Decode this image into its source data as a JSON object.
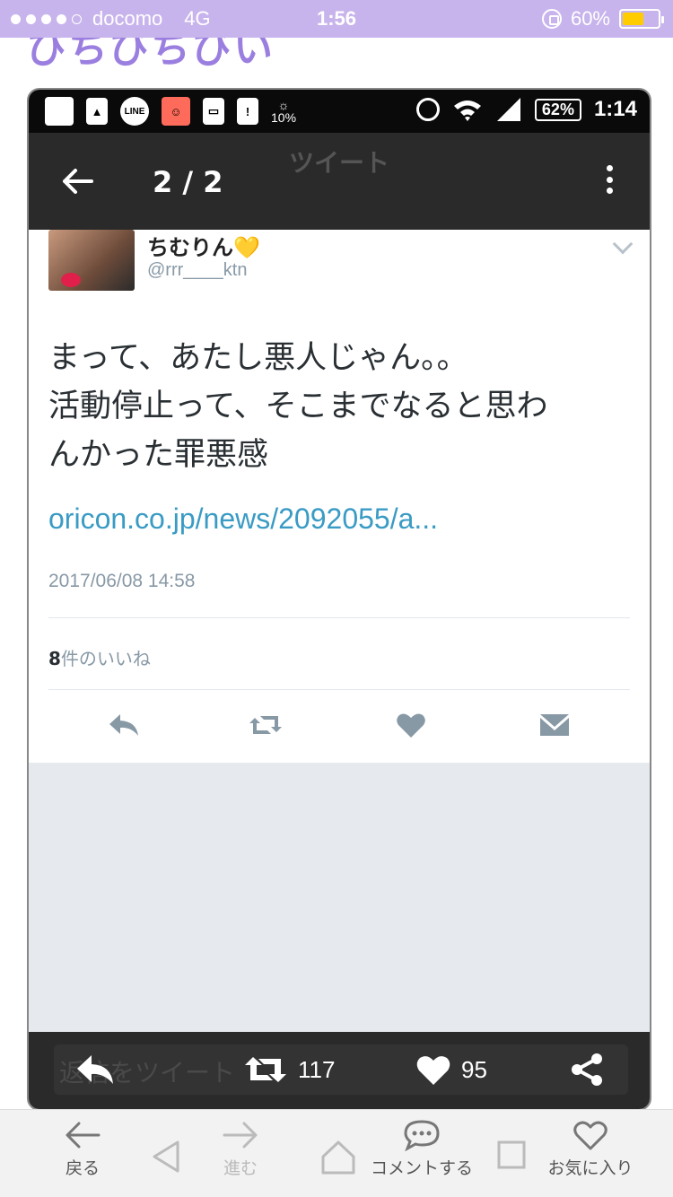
{
  "ios_status": {
    "carrier": "docomo",
    "network": "4G",
    "time": "1:56",
    "battery": "60%",
    "battery_level": 0.6
  },
  "header_cutoff_text": "びちびちびい",
  "android_status": {
    "weather": "10%",
    "battery": "62%",
    "time": "1:14",
    "line_label": "LINE"
  },
  "viewer": {
    "ghost_title": "ツイート",
    "page_count": "2 / 2"
  },
  "tweet": {
    "display_name": "ちむりん",
    "name_emoji": "💛",
    "handle": "@rrr____ktn",
    "text_lines": [
      "まって、あたし悪人じゃん。。",
      "活動停止って、そこまでなると思わ",
      "んかった罪悪感"
    ],
    "link": "oricon.co.jp/news/2092055/a...",
    "timestamp": "2017/06/08 14:58",
    "likes_count": "8",
    "likes_label": "件のいいね"
  },
  "bottom_bar": {
    "ghost_reply": "返信をツイート",
    "retweets": "117",
    "likes": "95"
  },
  "browser_toolbar": {
    "back": "戻る",
    "forward": "進む",
    "comment": "コメントする",
    "favorite": "お気に入り"
  },
  "colors": {
    "ios_bar": "#c8b4ec",
    "accent_purple": "#9b7fe0",
    "link_blue": "#3a9bc4",
    "twitter_gray": "#8899a6",
    "battery_yellow": "#ffcc00"
  }
}
